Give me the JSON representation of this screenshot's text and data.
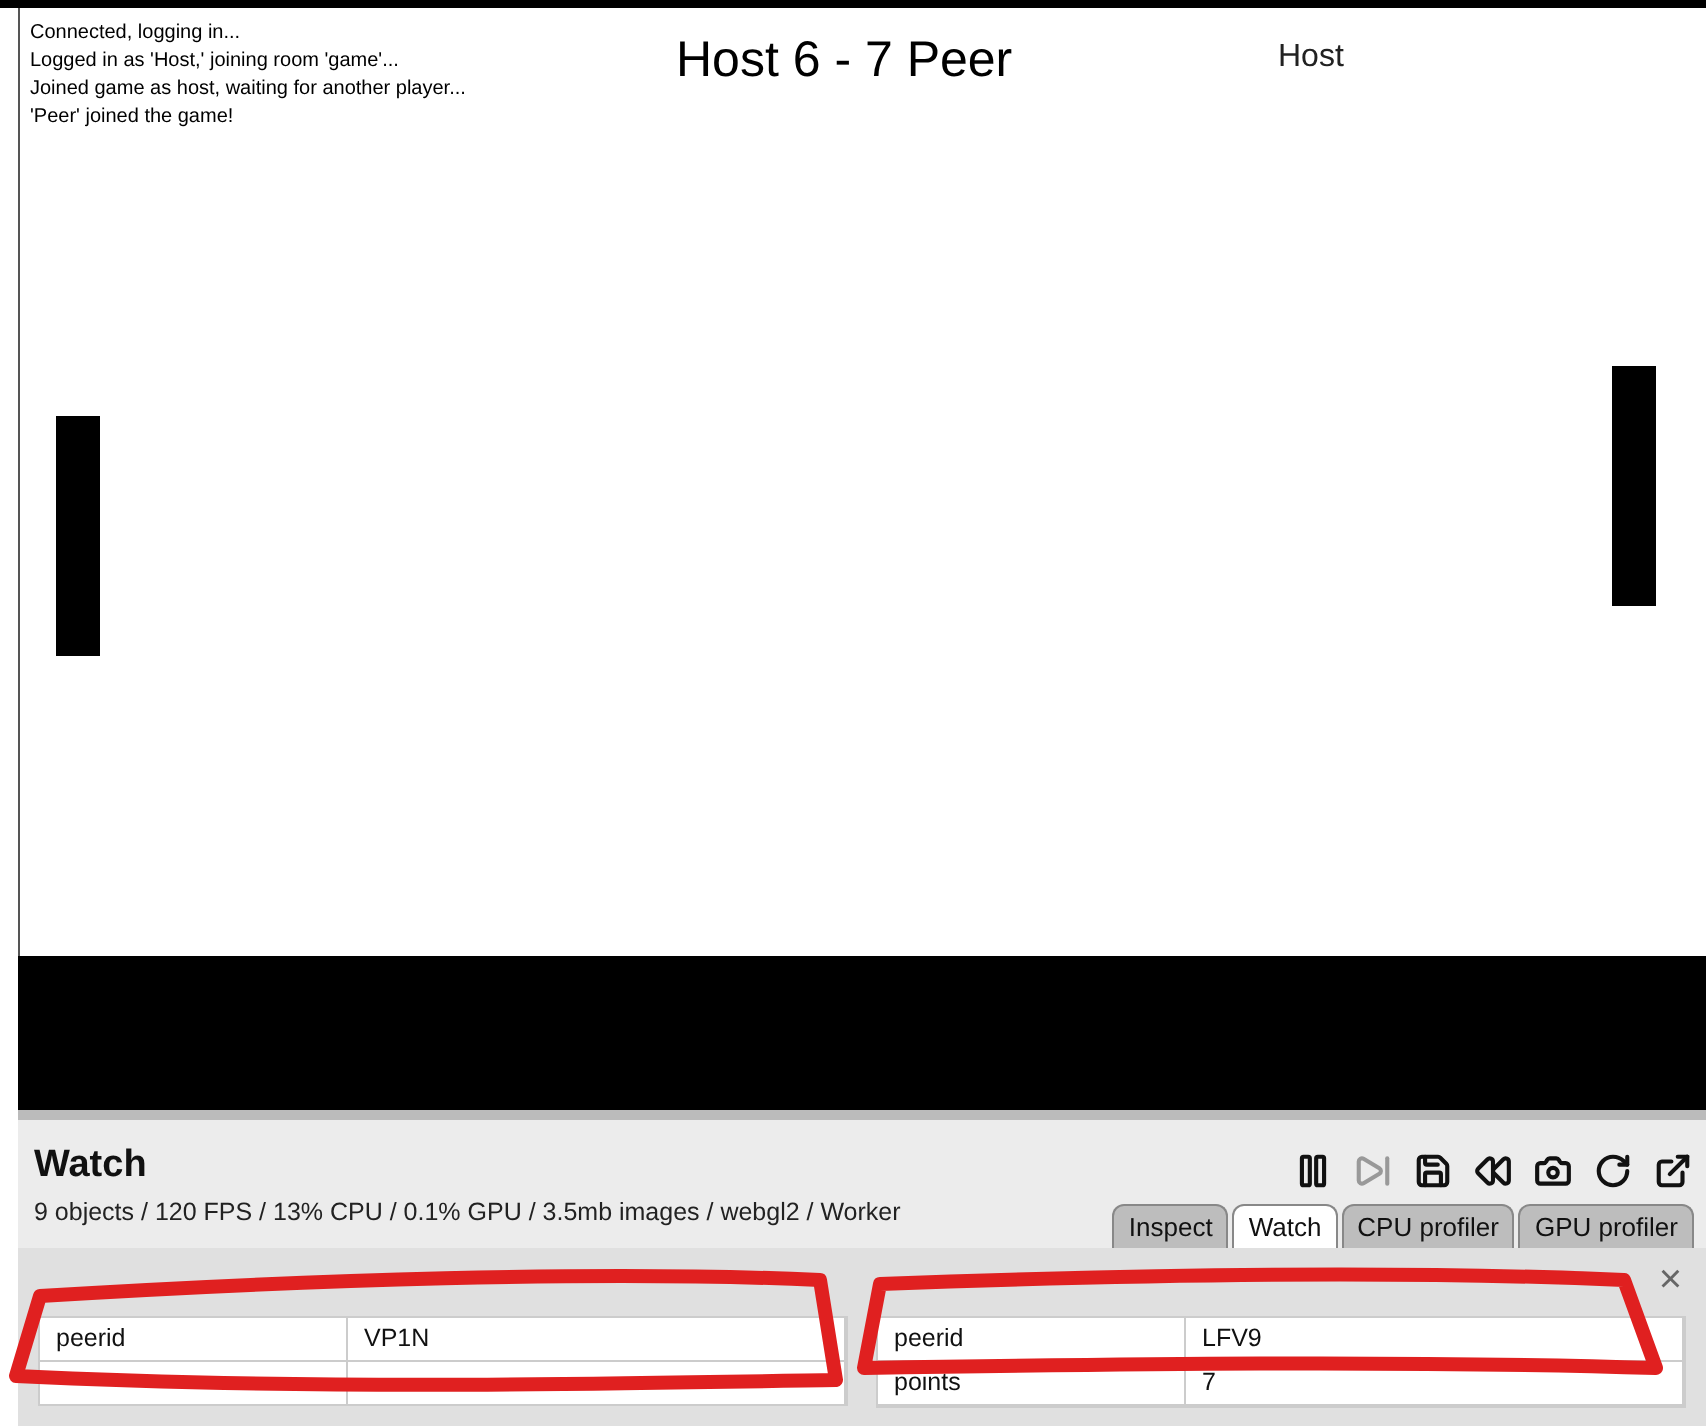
{
  "game": {
    "log": [
      "Connected, logging in...",
      "Logged in as 'Host,' joining room 'game'...",
      "Joined game as host, waiting for another player...",
      "'Peer' joined the game!"
    ],
    "score": "Host 6 - 7 Peer",
    "role": "Host"
  },
  "debugger": {
    "title": "Watch",
    "stats": "9 objects / 120 FPS / 13% CPU / 0.1% GPU / 3.5mb images / webgl2 / Worker",
    "tabs": [
      {
        "label": "Inspect",
        "selected": false
      },
      {
        "label": "Watch",
        "selected": true
      },
      {
        "label": "CPU profiler",
        "selected": false
      },
      {
        "label": "GPU profiler",
        "selected": false
      }
    ],
    "close": "×",
    "tables": [
      {
        "rows": [
          {
            "name": "peerid",
            "value": "VP1N"
          }
        ]
      },
      {
        "rows": [
          {
            "name": "peerid",
            "value": "LFV9"
          },
          {
            "name": "points",
            "value": "7"
          }
        ]
      }
    ]
  }
}
